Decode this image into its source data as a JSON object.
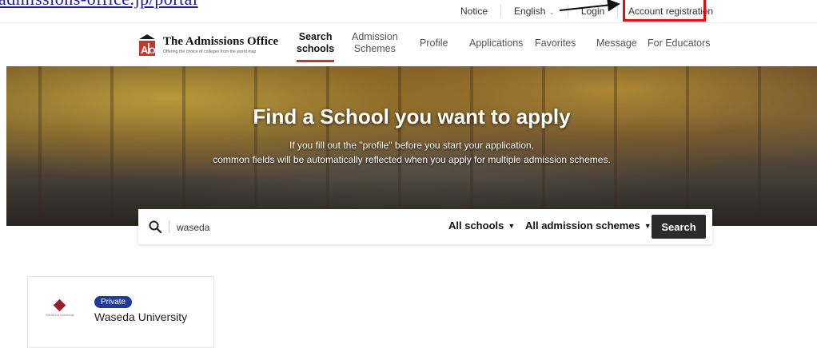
{
  "banner_text": "admissions-office.jp/portal",
  "util_nav": {
    "notice": "Notice",
    "language": "English",
    "login": "Login",
    "account_registration": "Account registration"
  },
  "brand": {
    "title": "The Admissions Office",
    "tagline": "Offering the choice of colleges from the world map",
    "mark": "AO"
  },
  "main_nav": {
    "search_schools": [
      "Search",
      "schools"
    ],
    "admission_schemes": [
      "Admission",
      "Schemes"
    ],
    "profile": "Profile",
    "applications": "Applications",
    "favorites": "Favorites",
    "message": "Message",
    "for_educators": "For Educators"
  },
  "hero": {
    "title": "Find a School you want to apply",
    "line1": "If you fill out the \"profile\" before you start your application,",
    "line2": "common fields will be automatically reflected when you apply for multiple admission schemes."
  },
  "search": {
    "value": "waseda",
    "school_filter": "All schools",
    "scheme_filter": "All admission schemes",
    "button": "Search"
  },
  "results": [
    {
      "badge": "Private",
      "name": "Waseda University",
      "logo_caption": "WASEDA University"
    }
  ],
  "colors": {
    "accent_red": "#c0392b",
    "highlight_red": "#e01010",
    "badge_blue": "#1e3a9a",
    "button_dark": "#2b2b2b"
  }
}
